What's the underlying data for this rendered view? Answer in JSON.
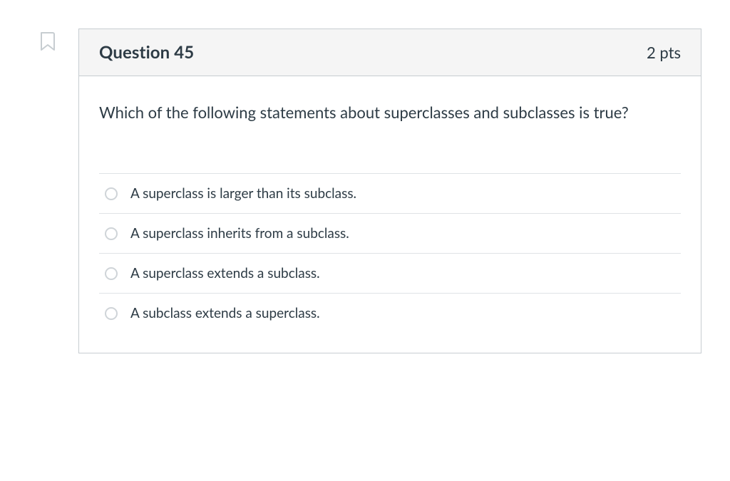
{
  "question": {
    "title": "Question 45",
    "points": "2 pts",
    "prompt": "Which of the following statements about superclasses and subclasses is true?",
    "options": [
      {
        "label": "A superclass is larger than its subclass."
      },
      {
        "label": "A superclass inherits from a subclass."
      },
      {
        "label": "A superclass extends a subclass."
      },
      {
        "label": "A subclass extends a superclass."
      }
    ]
  }
}
